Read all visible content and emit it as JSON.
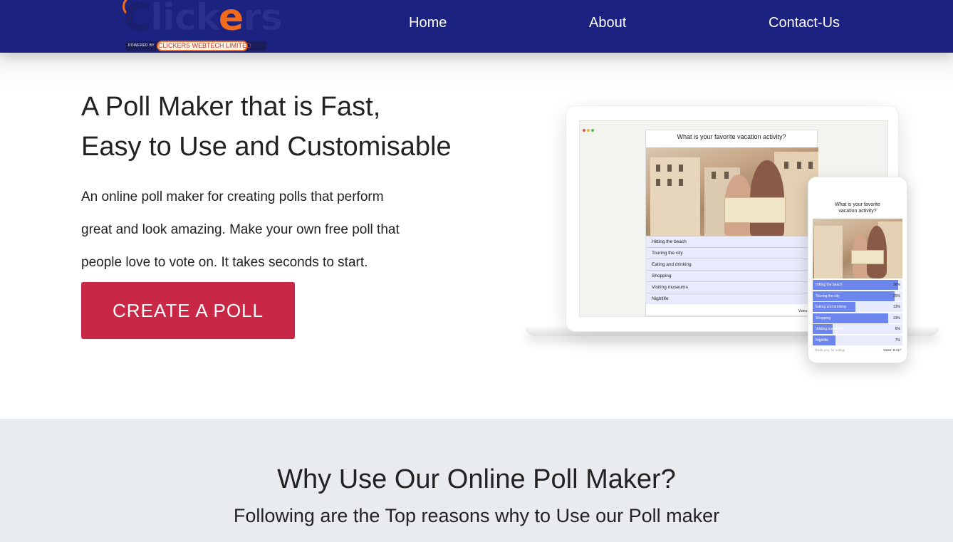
{
  "brand": {
    "logo_text": "Clickers",
    "powered_by": "POWERED BY",
    "company": "CLICKERS WEBTECH LIMITED"
  },
  "nav": {
    "items": [
      {
        "label": "Home"
      },
      {
        "label": "About"
      },
      {
        "label": "Contact-Us"
      }
    ]
  },
  "hero": {
    "title_lines": [
      "A Poll Maker that is Fast,",
      "Easy to Use and Customisable"
    ],
    "desc_lines": [
      "An online poll maker for creating polls that perform",
      "great and look amazing. Make your own free poll that",
      "people love to vote on. It takes seconds to start."
    ],
    "cta_label": "CREATE A POLL"
  },
  "mockup": {
    "question": "What is your favorite vacation activity?",
    "phone_question_lines": [
      "What is your favorite",
      "vacation activity?"
    ],
    "options": [
      {
        "label": "Hitting the beach",
        "pct": "26%",
        "value": 26
      },
      {
        "label": "Touring the city",
        "pct": "25%",
        "value": 25
      },
      {
        "label": "Eating and drinking",
        "pct": "13%",
        "value": 13
      },
      {
        "label": "Shopping",
        "pct": "23%",
        "value": 23
      },
      {
        "label": "Visiting museums",
        "pct": "6%",
        "value": 6
      },
      {
        "label": "Nightlife",
        "pct": "7%",
        "value": 7
      }
    ],
    "laptop_votes": "Votes: 9,2",
    "phone_votes": "Votes: 9,217",
    "thanks": "Thank you, for voting!",
    "colors": {
      "bar": "#6c86ee",
      "row": "#e8ebfb"
    }
  },
  "why": {
    "title": "Why Use Our Online Poll Maker?",
    "subtitle": "Following are the Top reasons why to Use our Poll maker"
  },
  "colors": {
    "navbar": "#1c2280",
    "cta": "#c82845",
    "accent_orange": "#f26a1b",
    "section_bg": "#e9ecef"
  }
}
